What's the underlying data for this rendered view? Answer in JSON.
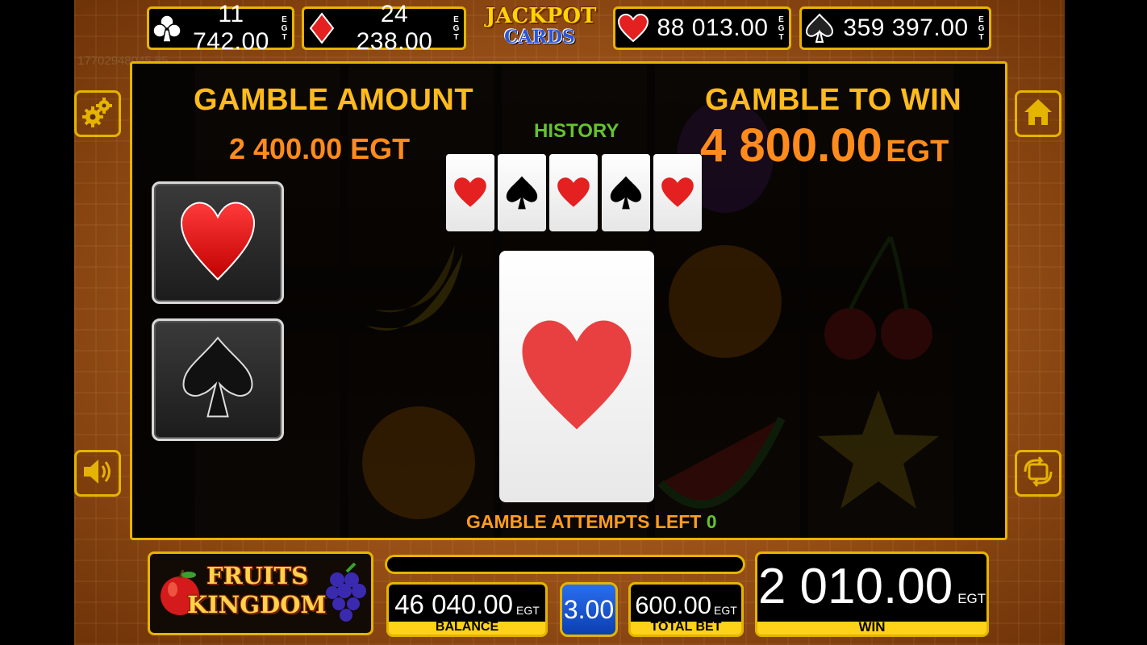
{
  "jackpots": [
    {
      "suit": "club",
      "value": "11 742.00",
      "currency": "EGT"
    },
    {
      "suit": "diamond",
      "value": "24 238.00",
      "currency": "EGT"
    },
    {
      "suit": "heart",
      "value": "88 013.00",
      "currency": "EGT"
    },
    {
      "suit": "spade",
      "value": "359 397.00",
      "currency": "EGT"
    }
  ],
  "jackpot_logo": {
    "line1": "JACKPOT",
    "line2": "CARDS"
  },
  "session_id": "17702948045 85",
  "gamble": {
    "amount_label": "GAMBLE AMOUNT",
    "amount_value": "2 400.00 EGT",
    "to_win_label": "GAMBLE TO WIN",
    "to_win_value": "4 800.00",
    "to_win_currency": "EGT",
    "history_label": "HISTORY",
    "history": [
      "heart",
      "spade",
      "heart",
      "spade",
      "heart"
    ],
    "choices": [
      "red-heart",
      "black-spade"
    ],
    "current_card": "heart",
    "attempts_label": "GAMBLE ATTEMPTS LEFT",
    "attempts_value": "0"
  },
  "side_buttons": {
    "settings": "gear-icon",
    "home": "home-icon",
    "sound": "speaker-icon",
    "autoplay": "repeat-icon"
  },
  "game_logo": {
    "line1": "FRUITS",
    "line2": "KINGDOM"
  },
  "bottom": {
    "balance_value": "46 040.00",
    "balance_currency": "EGT",
    "balance_label": "BALANCE",
    "denomination": "3.00",
    "total_bet_value": "600.00",
    "total_bet_currency": "EGT",
    "total_bet_label": "TOTAL BET",
    "win_value": "2 010.00",
    "win_currency": "EGT",
    "win_label": "WIN"
  },
  "colors": {
    "gold_border": "#e5b400",
    "gamble_label": "#ffbb1c",
    "amount": "#ff8b1c",
    "history": "#66c22e",
    "heart_red": "#e42020"
  }
}
